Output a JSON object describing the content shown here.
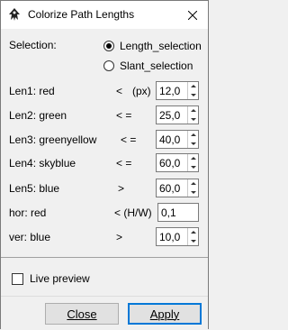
{
  "window": {
    "title": "Colorize Path Lengths"
  },
  "selection": {
    "label": "Selection:",
    "options": [
      {
        "label": "Length_selection",
        "checked": true
      },
      {
        "label": "Slant_selection",
        "checked": false
      }
    ]
  },
  "rows": [
    {
      "label": "Len1: red",
      "op": "<",
      "unit": "(px)",
      "value": "12,0"
    },
    {
      "label": "Len2: green",
      "op": "< =",
      "unit": "",
      "value": "25,0"
    },
    {
      "label": "Len3: greenyellow",
      "op": "< =",
      "unit": "",
      "value": "40,0"
    },
    {
      "label": "Len4: skyblue",
      "op": "< =",
      "unit": "",
      "value": "60,0"
    },
    {
      "label": "Len5: blue",
      "op": ">",
      "unit": "",
      "value": "60,0"
    },
    {
      "label": "hor: red",
      "op": "< (H/W)",
      "unit": "",
      "value": "0,1"
    },
    {
      "label": "ver: blue",
      "op": ">",
      "unit": "",
      "value": "10,0"
    }
  ],
  "live_preview": {
    "label": "Live preview",
    "checked": false
  },
  "buttons": {
    "close": "Close",
    "apply": "Apply"
  },
  "colors": {
    "accent": "#0078d7"
  }
}
